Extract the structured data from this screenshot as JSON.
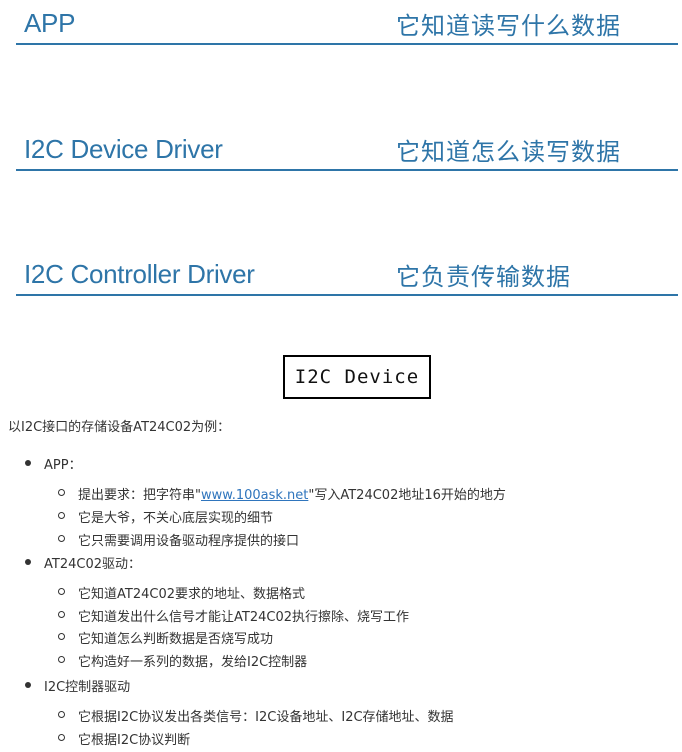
{
  "layers": [
    {
      "name": "APP",
      "role": "它知道读写什么数据"
    },
    {
      "name": "I2C Device Driver",
      "role": "它知道怎么读写数据"
    },
    {
      "name": "I2C Controller Driver",
      "role": "它负责传输数据"
    }
  ],
  "device_box": "I2C Device",
  "intro": "以I2C接口的存储设备AT24C02为例：",
  "sections": [
    {
      "title": "APP：",
      "items": [
        {
          "pre": "提出要求：把字符串\"",
          "link": "www.100ask.net",
          "post": "\"写入AT24C02地址16开始的地方"
        },
        {
          "text": "它是大爷，不关心底层实现的细节"
        },
        {
          "text": "它只需要调用设备驱动程序提供的接口"
        }
      ]
    },
    {
      "title": "AT24C02驱动：",
      "items": [
        {
          "text": "它知道AT24C02要求的地址、数据格式"
        },
        {
          "text": "它知道发出什么信号才能让AT24C02执行擦除、烧写工作"
        },
        {
          "text": "它知道怎么判断数据是否烧写成功"
        },
        {
          "text": "它构造好一系列的数据，发给I2C控制器"
        }
      ]
    },
    {
      "title": "I2C控制器驱动",
      "items": [
        {
          "text": "它根据I2C协议发出各类信号：I2C设备地址、I2C存储地址、数据"
        },
        {
          "text": "它根据I2C协议判断"
        }
      ]
    }
  ]
}
